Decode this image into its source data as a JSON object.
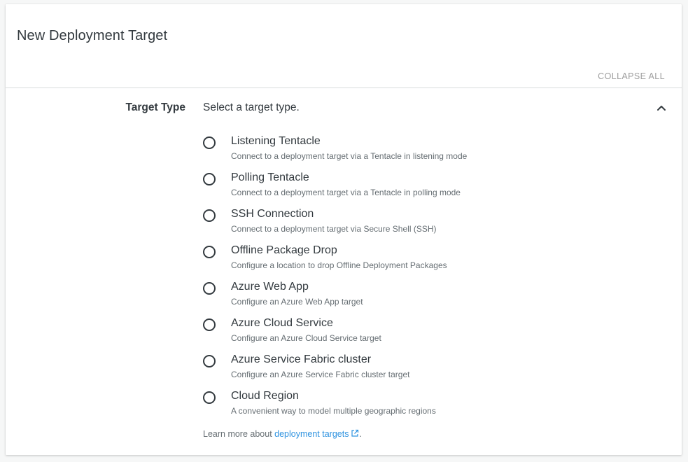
{
  "card": {
    "title": "New Deployment Target",
    "collapse_all_label": "COLLAPSE ALL"
  },
  "target_type": {
    "label": "Target Type",
    "summary": "Select a target type.",
    "expanded_icon": "chevron-up-icon",
    "options": [
      {
        "label": "Listening Tentacle",
        "description": "Connect to a deployment target via a Tentacle in listening mode",
        "selected": false
      },
      {
        "label": "Polling Tentacle",
        "description": "Connect to a deployment target via a Tentacle in polling mode",
        "selected": false
      },
      {
        "label": "SSH Connection",
        "description": "Connect to a deployment target via Secure Shell (SSH)",
        "selected": false
      },
      {
        "label": "Offline Package Drop",
        "description": "Configure a location to drop Offline Deployment Packages",
        "selected": false
      },
      {
        "label": "Azure Web App",
        "description": "Configure an Azure Web App target",
        "selected": false
      },
      {
        "label": "Azure Cloud Service",
        "description": "Configure an Azure Cloud Service target",
        "selected": false
      },
      {
        "label": "Azure Service Fabric cluster",
        "description": "Configure an Azure Service Fabric cluster target",
        "selected": false
      },
      {
        "label": "Cloud Region",
        "description": "A convenient way to model multiple geographic regions",
        "selected": false
      }
    ],
    "learn_more": {
      "prefix": "Learn more about ",
      "link_text": "deployment targets",
      "suffix": ".",
      "link_icon": "external-link-icon"
    }
  },
  "colors": {
    "text_primary": "#333a3f",
    "text_secondary": "#666e73",
    "link": "#2f93e0",
    "muted": "#9e9e9e",
    "divider": "#d9dcdd"
  }
}
